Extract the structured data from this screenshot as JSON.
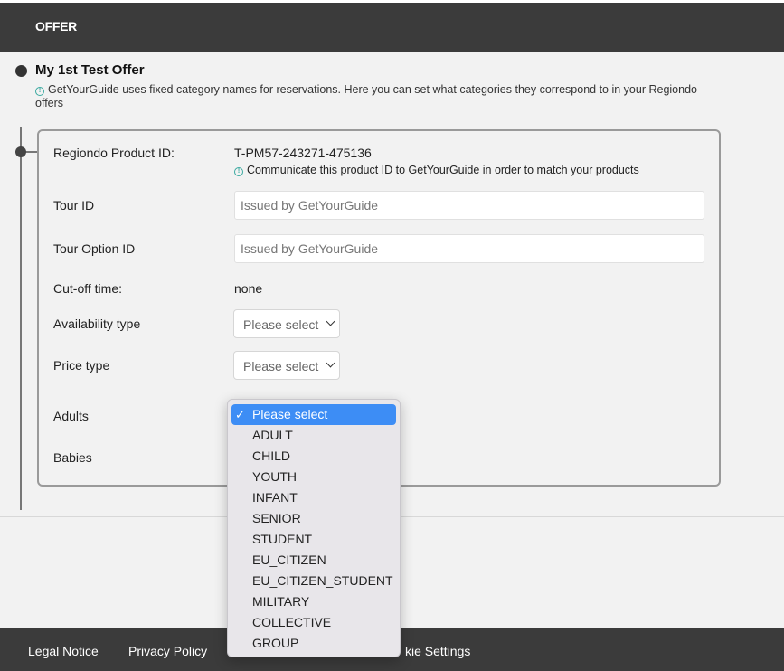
{
  "header": {
    "title": "OFFER"
  },
  "offer": {
    "title": "My 1st Test Offer",
    "info_text": "GetYourGuide uses fixed category names for reservations. Here you can set what categories they correspond to in your Regiondo offers"
  },
  "form": {
    "product_id_label": "Regiondo Product ID:",
    "product_id_value": "T-PM57-243271-475136",
    "product_id_hint": "Communicate this product ID to GetYourGuide in order to match your products",
    "tour_id_label": "Tour ID",
    "tour_id_placeholder": "Issued by GetYourGuide",
    "tour_option_id_label": "Tour Option ID",
    "tour_option_id_placeholder": "Issued by GetYourGuide",
    "cutoff_label": "Cut-off time:",
    "cutoff_value": "none",
    "availability_label": "Availability type",
    "availability_selected": "Please select",
    "price_type_label": "Price type",
    "price_type_selected": "Please select",
    "adults_label": "Adults",
    "babies_label": "Babies"
  },
  "dropdown": {
    "options": [
      "Please select",
      "ADULT",
      "CHILD",
      "YOUTH",
      "INFANT",
      "SENIOR",
      "STUDENT",
      "EU_CITIZEN",
      "EU_CITIZEN_STUDENT",
      "MILITARY",
      "COLLECTIVE",
      "GROUP"
    ],
    "check_mark": "✓"
  },
  "footer": {
    "legal_notice": "Legal Notice",
    "privacy_policy": "Privacy Policy",
    "cookie_settings_partial": "kie Settings"
  },
  "icons": {
    "info": "info-icon",
    "chevron": "chevron-down-icon",
    "check": "check-icon"
  },
  "colors": {
    "header_bg": "#3b3b3b",
    "info_accent": "#3aa9a0",
    "dropdown_highlight": "#3d8df5"
  }
}
